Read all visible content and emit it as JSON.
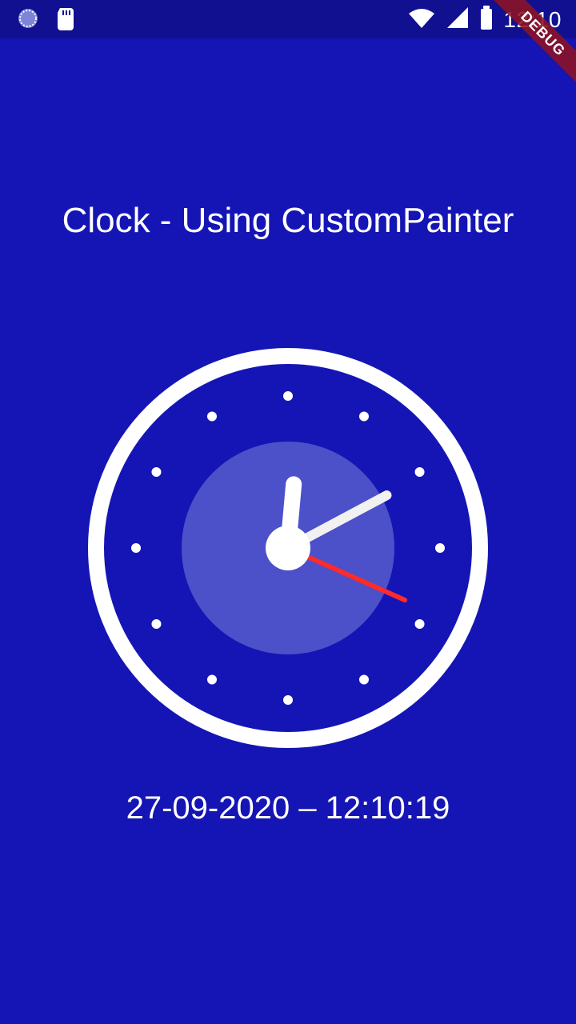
{
  "status_bar": {
    "time": "12:10",
    "icons": [
      "sync-icon",
      "sd-card-icon",
      "wifi-icon",
      "signal-icon",
      "battery-icon"
    ]
  },
  "debug_banner": {
    "label": "DEBUG"
  },
  "main": {
    "title": "Clock - Using CustomPainter",
    "datetime": "27-09-2020 – 12:10:19"
  },
  "clock": {
    "hour": 12,
    "minute": 10,
    "second": 19,
    "colors": {
      "background": "#1515b5",
      "outline": "#ffffff",
      "inner_disc": "#4c50c9",
      "hour_hand": "#ffffff",
      "minute_hand": "#f1f1f1",
      "second_hand": "#ff2a2a",
      "center": "#ffffff"
    }
  }
}
